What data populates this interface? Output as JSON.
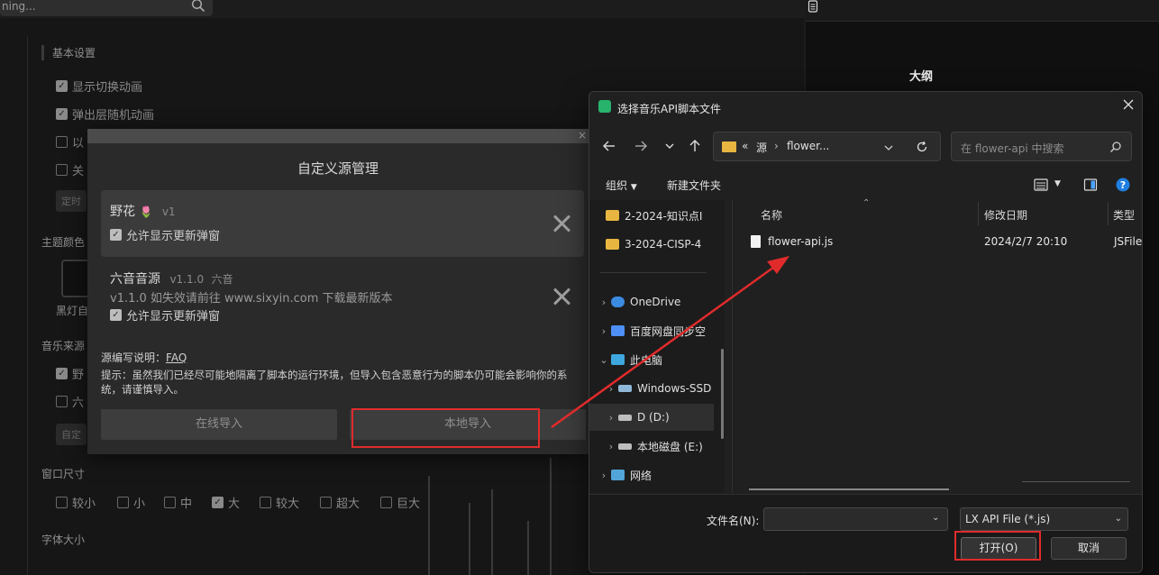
{
  "background": {
    "search_text": "ning...",
    "section_basic": "基本设置",
    "checks": [
      {
        "label": "显示切换动画",
        "checked": true
      },
      {
        "label": "弹出层随机动画",
        "checked": true
      },
      {
        "label": "以",
        "checked": false
      },
      {
        "label": "关",
        "checked": false
      }
    ],
    "pill_1": "定时",
    "section_theme": "主题颜色",
    "theme_label": "黑灯自",
    "section_music_source": "音乐来源",
    "source_checks": [
      {
        "label": "野",
        "checked": true
      },
      {
        "label": "六",
        "checked": false
      }
    ],
    "pill_2": "自定",
    "section_window_size": "窗口尺寸",
    "window_sizes": [
      {
        "label": "较小",
        "checked": false
      },
      {
        "label": "小",
        "checked": false
      },
      {
        "label": "中",
        "checked": false
      },
      {
        "label": "大",
        "checked": true
      },
      {
        "label": "较大",
        "checked": false
      },
      {
        "label": "超大",
        "checked": false
      },
      {
        "label": "巨大",
        "checked": false
      }
    ],
    "section_font_size": "字体大小",
    "right_outline": "大纲"
  },
  "source_manager": {
    "title": "自定义源管理",
    "items": [
      {
        "name": "野花",
        "emoji": "🌷",
        "version": "v1",
        "author": "",
        "desc": "",
        "allow_label": "允许显示更新弹窗"
      },
      {
        "name": "六音音源",
        "emoji": "",
        "version": "v1.1.0",
        "author": "六音",
        "desc": "v1.1.0 如失效请前往 www.sixyin.com 下载最新版本",
        "allow_label": "允许显示更新弹窗"
      }
    ],
    "help_prefix": "源编写说明：",
    "help_link": "FAQ",
    "tip": "提示：虽然我们已经尽可能地隔离了脚本的运行环境，但导入包含恶意行为的脚本仍可能会影响你的系统，请谨慎导入。",
    "btn_online": "在线导入",
    "btn_local": "本地导入",
    "close_glyph": "×"
  },
  "file_dialog": {
    "title": "选择音乐API脚本文件",
    "address": {
      "overflow": "«",
      "crumbs": [
        "源",
        "flower..."
      ]
    },
    "search_placeholder": "在 flower-api 中搜索",
    "toolbar": {
      "organize": "组织",
      "new_folder": "新建文件夹"
    },
    "nav": [
      {
        "label": "2-2024-知识点I",
        "icon": "folder-icon"
      },
      {
        "label": "3-2024-CISP-4",
        "icon": "folder-icon"
      },
      {
        "label": "OneDrive",
        "icon": "cloud-icon"
      },
      {
        "label": "百度网盘同步空",
        "icon": "baidu-icon"
      },
      {
        "label": "此电脑",
        "icon": "computer-icon"
      },
      {
        "label": "Windows-SSD",
        "icon": "drive-icon"
      },
      {
        "label": "D (D:)",
        "icon": "drive-icon"
      },
      {
        "label": "本地磁盘 (E:)",
        "icon": "drive-icon"
      },
      {
        "label": "网络",
        "icon": "network-icon"
      }
    ],
    "columns": {
      "name": "名称",
      "date": "修改日期",
      "type": "类型"
    },
    "files": [
      {
        "name": "flower-api.js",
        "date": "2024/2/7 20:10",
        "type": "JSFile"
      }
    ],
    "filename_label": "文件名(N):",
    "filename_value": "",
    "filetype": "LX API File (*.js)",
    "btn_open": "打开(O)",
    "btn_cancel": "取消"
  },
  "colors": {
    "annotation_red": "#e12b2b",
    "folder": "#e8b640",
    "app_green": "#27b36b",
    "help_blue": "#1f7fe0"
  }
}
